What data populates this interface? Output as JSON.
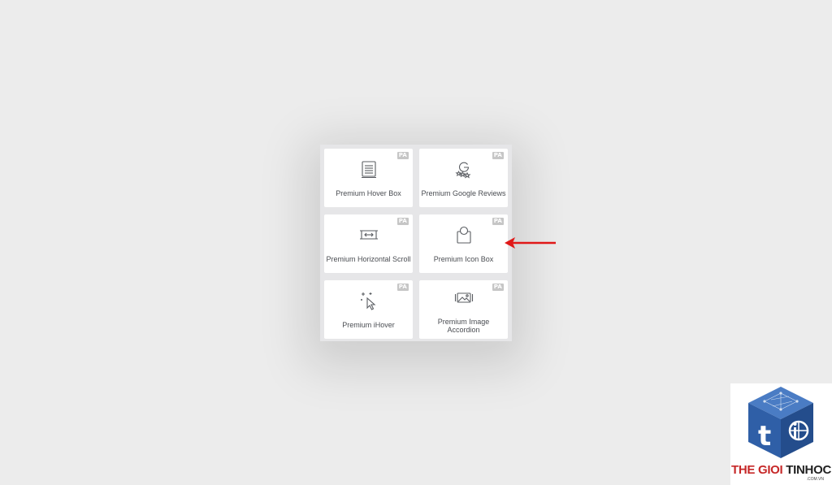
{
  "widgets": [
    {
      "name": "Premium Hover Box",
      "badge": "PA",
      "icon": "document-list-icon"
    },
    {
      "name": "Premium Google Reviews",
      "badge": "PA",
      "icon": "google-reviews-icon"
    },
    {
      "name": "Premium Horizontal Scroll",
      "badge": "PA",
      "icon": "horizontal-scroll-icon"
    },
    {
      "name": "Premium Icon Box",
      "badge": "PA",
      "icon": "icon-box-icon"
    },
    {
      "name": "Premium iHover",
      "badge": "PA",
      "icon": "sparkle-cursor-icon"
    },
    {
      "name": "Premium Image Accordion",
      "badge": "PA",
      "icon": "image-accordion-icon"
    }
  ],
  "annotation": {
    "icon": "red-arrow-icon",
    "color": "#e01818"
  },
  "watermark": {
    "brand_red": "THE GIOI",
    "brand_dark": "TINHOC",
    "domain": ".COM.VN",
    "icon": "cube-logo-icon",
    "colors": {
      "cube": "#2f5fa7",
      "text_red": "#c62828",
      "text_dark": "#222222"
    }
  }
}
